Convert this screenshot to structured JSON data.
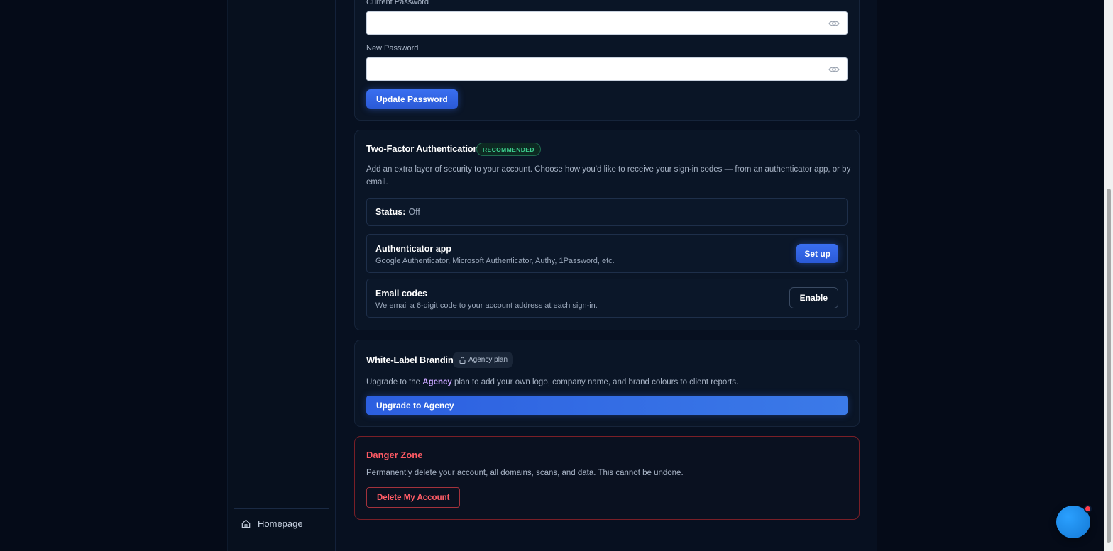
{
  "sidebar": {
    "homepage_label": "Homepage",
    "homepage_icon": "home-icon"
  },
  "password": {
    "current_label": "Current Password",
    "current_value": "",
    "new_label": "New Password",
    "new_value": "",
    "update_button": "Update Password",
    "toggle_icon": "eye-icon"
  },
  "two_factor": {
    "title": "Two-Factor Authentication",
    "badge": "RECOMMENDED",
    "description": "Add an extra layer of security to your account. Choose how you'd like to receive your sign-in codes — from an authenticator app, or by email.",
    "status_label": "Status:",
    "status_value": "Off",
    "options": [
      {
        "title": "Authenticator app",
        "subtitle": "Google Authenticator, Microsoft Authenticator, Authy, 1Password, etc.",
        "button": "Set up"
      },
      {
        "title": "Email codes",
        "subtitle": "We email a 6-digit code to your account address at each sign-in.",
        "button": "Enable"
      }
    ]
  },
  "white_label": {
    "title": "White-Label Branding",
    "plan_badge": "Agency plan",
    "plan_icon": "lock-icon",
    "desc_before": "Upgrade to the ",
    "desc_accent": "Agency",
    "desc_after": " plan to add your own logo, company name, and brand colours to client reports.",
    "upgrade_button": "Upgrade to Agency"
  },
  "danger_zone": {
    "title": "Danger Zone",
    "description": "Permanently delete your account, all domains, scans, and data. This cannot be undone.",
    "delete_button": "Delete My Account"
  },
  "colors": {
    "accent": "#3a6ff0",
    "danger": "#ff5a64",
    "success": "#3ccf8e",
    "background": "#050b18"
  }
}
